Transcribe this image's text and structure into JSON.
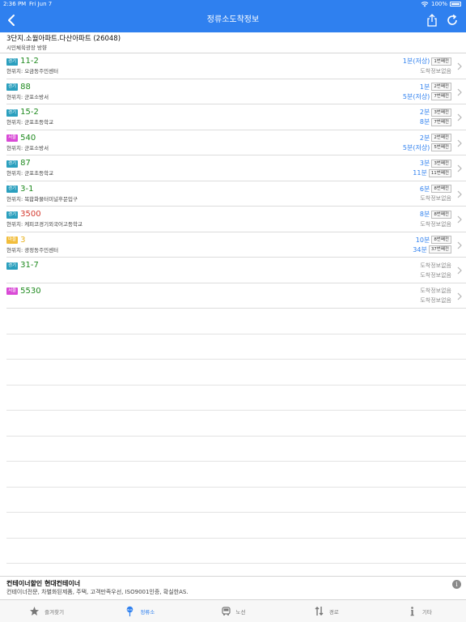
{
  "status": {
    "time": "2:36 PM",
    "date": "Fri Jun 7",
    "battery": "100%"
  },
  "nav": {
    "title": "정류소도착정보"
  },
  "stop": {
    "name": "3단지.소월아파트.다산아파트 (26048)",
    "direction": "시민체육광장 방향"
  },
  "region_colors": {
    "경기": "#2a9fbe",
    "서울": "#d94ad6",
    "마을": "#f2bd3a"
  },
  "routes": [
    {
      "region": "경기",
      "route": "11-2",
      "route_color": "#1f8a1f",
      "location": "현위치: 오금동주민센터",
      "arrivals": [
        {
          "time": "1분(저상)",
          "stops": "1번째전"
        },
        {
          "time": "도착정보없음",
          "stops": ""
        }
      ]
    },
    {
      "region": "경기",
      "route": "88",
      "route_color": "#1f8a1f",
      "location": "현위치: 군포소방서",
      "arrivals": [
        {
          "time": "1분",
          "stops": "2번째전"
        },
        {
          "time": "5분(저상)",
          "stops": "7번째전"
        }
      ]
    },
    {
      "region": "경기",
      "route": "15-2",
      "route_color": "#1f8a1f",
      "location": "현위치: 군포초등학교",
      "arrivals": [
        {
          "time": "2분",
          "stops": "3번째전"
        },
        {
          "time": "8분",
          "stops": "7번째전"
        }
      ]
    },
    {
      "region": "서울",
      "route": "540",
      "route_color": "#1f8a1f",
      "location": "현위치: 군포소방서",
      "arrivals": [
        {
          "time": "2분",
          "stops": "2번째전"
        },
        {
          "time": "5분(저상)",
          "stops": "5번째전"
        }
      ]
    },
    {
      "region": "경기",
      "route": "87",
      "route_color": "#1f8a1f",
      "location": "현위치: 군포초등학교",
      "arrivals": [
        {
          "time": "3분",
          "stops": "3번째전"
        },
        {
          "time": "11분",
          "stops": "11번째전"
        }
      ]
    },
    {
      "region": "경기",
      "route": "3-1",
      "route_color": "#1f8a1f",
      "location": "현위치: 복합화물터미널후문입구",
      "arrivals": [
        {
          "time": "6분",
          "stops": "8번째전"
        },
        {
          "time": "도착정보없음",
          "stops": ""
        }
      ]
    },
    {
      "region": "경기",
      "route": "3500",
      "route_color": "#d43a2f",
      "location": "현위치: 케피코경기외국어고등학교",
      "arrivals": [
        {
          "time": "8분",
          "stops": "8번째전"
        },
        {
          "time": "도착정보없음",
          "stops": ""
        }
      ]
    },
    {
      "region": "마을",
      "route": "3",
      "route_color": "#e8b21f",
      "location": "현위치: 광정동주민센터",
      "arrivals": [
        {
          "time": "10분",
          "stops": "8번째전"
        },
        {
          "time": "34분",
          "stops": "37번째전"
        }
      ]
    },
    {
      "region": "경기",
      "route": "31-7",
      "route_color": "#1f8a1f",
      "location": "",
      "arrivals": [
        {
          "time": "도착정보없음",
          "stops": ""
        },
        {
          "time": "도착정보없음",
          "stops": ""
        }
      ]
    },
    {
      "region": "서울",
      "route": "5530",
      "route_color": "#1f8a1f",
      "location": "",
      "arrivals": [
        {
          "time": "도착정보없음",
          "stops": ""
        },
        {
          "time": "도착정보없음",
          "stops": ""
        }
      ]
    }
  ],
  "ad": {
    "title": "컨테이너할인 현대컨테이너",
    "description": "컨테이너전문, 차별화된제품, 주택, 고객만족우선, ISO9001인증, 확실한AS."
  },
  "tabs": [
    {
      "label": "즐겨찾기",
      "icon": "star-icon",
      "active": false
    },
    {
      "label": "정류소",
      "icon": "bus-stop-icon",
      "active": true
    },
    {
      "label": "노선",
      "icon": "bus-icon",
      "active": false
    },
    {
      "label": "경로",
      "icon": "route-arrows-icon",
      "active": false
    },
    {
      "label": "기타",
      "icon": "info-icon",
      "active": false
    }
  ]
}
